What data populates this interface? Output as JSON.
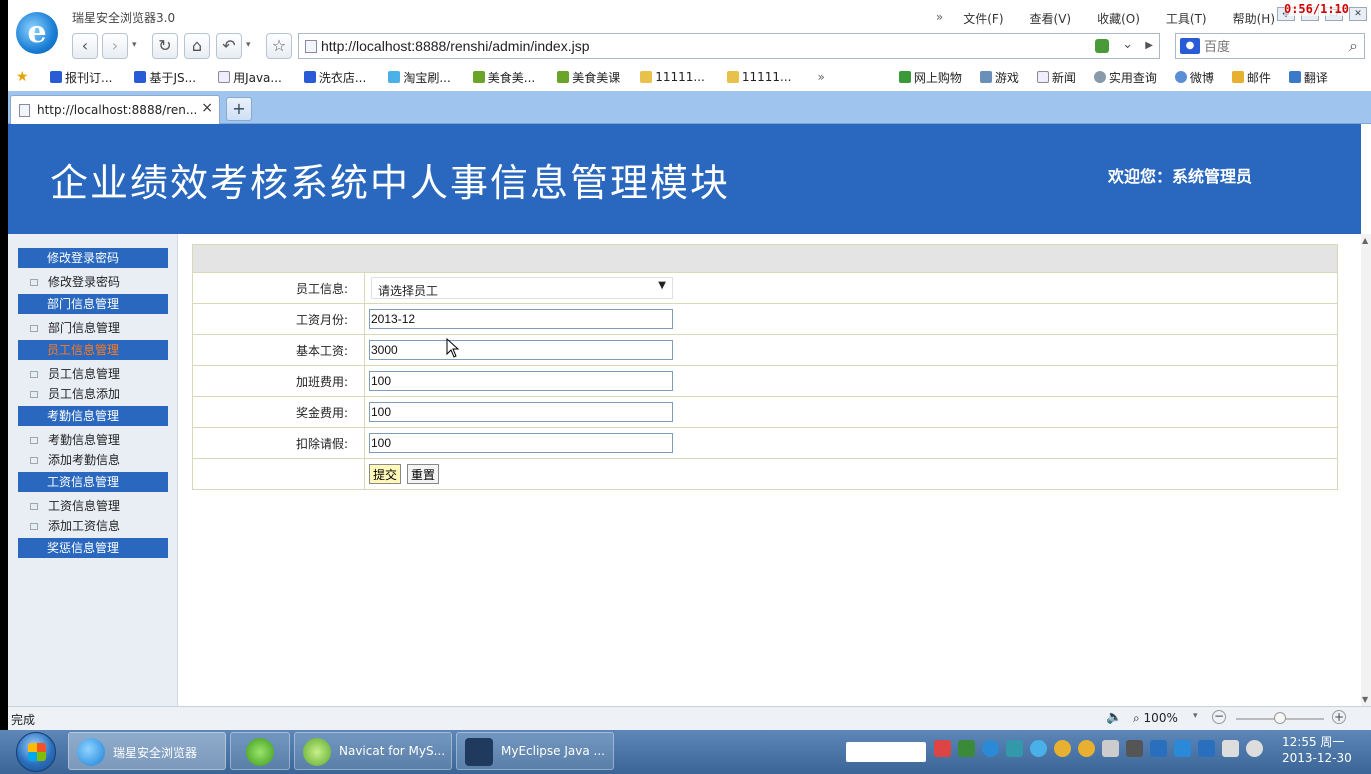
{
  "browser": {
    "app_title": "瑞星安全浏览器3.0",
    "timer": "0:56/1:10",
    "menu": {
      "more": "»",
      "items": [
        "文件(F)",
        "查看(V)",
        "收藏(O)",
        "工具(T)",
        "帮助(H)"
      ]
    },
    "address": "http://localhost:8888/renshi/admin/index.jsp",
    "search_placeholder": "百度",
    "favorites": [
      "报刊订...",
      "基于JS...",
      "用Java...",
      "洗衣店...",
      "淘宝刷...",
      "美食美...",
      "美食美课",
      "11111...",
      "11111..."
    ],
    "favorites_more": "»",
    "favorites_right": [
      "网上购物",
      "游戏",
      "新闻",
      "实用查询",
      "微博",
      "邮件",
      "翻译"
    ],
    "tab_label": "http://localhost:8888/ren...",
    "tab_close": "×",
    "new_tab": "+",
    "status_text": "完成",
    "zoom": "100%",
    "zoom_level": 0.5
  },
  "page": {
    "banner_title": "企业绩效考核系统中人事信息管理模块",
    "welcome_prefix": "欢迎您：",
    "welcome_user": "系统管理员",
    "sidebar": [
      {
        "group": "修改登录密码",
        "active": false,
        "items": [
          "修改登录密码"
        ]
      },
      {
        "group": "部门信息管理",
        "active": false,
        "items": [
          "部门信息管理"
        ]
      },
      {
        "group": "员工信息管理",
        "active": true,
        "items": [
          "员工信息管理",
          "员工信息添加"
        ]
      },
      {
        "group": "考勤信息管理",
        "active": false,
        "items": [
          "考勤信息管理",
          "添加考勤信息"
        ]
      },
      {
        "group": "工资信息管理",
        "active": false,
        "items": [
          "工资信息管理",
          "添加工资信息"
        ]
      },
      {
        "group": "奖惩信息管理",
        "active": false,
        "items": []
      }
    ],
    "form": {
      "employee_label": "员工信息:",
      "employee_selected": "请选择员工",
      "fields": [
        {
          "label": "工资月份:",
          "value": "2013-12"
        },
        {
          "label": "基本工资:",
          "value": "3000"
        },
        {
          "label": "加班费用:",
          "value": "100"
        },
        {
          "label": "奖金费用:",
          "value": "100"
        },
        {
          "label": "扣除请假:",
          "value": "100"
        }
      ],
      "submit_label": "提交",
      "reset_label": "重置"
    }
  },
  "taskbar": {
    "tasks": [
      "瑞星安全浏览器",
      "",
      "Navicat for MyS...",
      "MyEclipse Java ..."
    ],
    "clock_time": "12:55 周一",
    "clock_date": "2013-12-30"
  }
}
